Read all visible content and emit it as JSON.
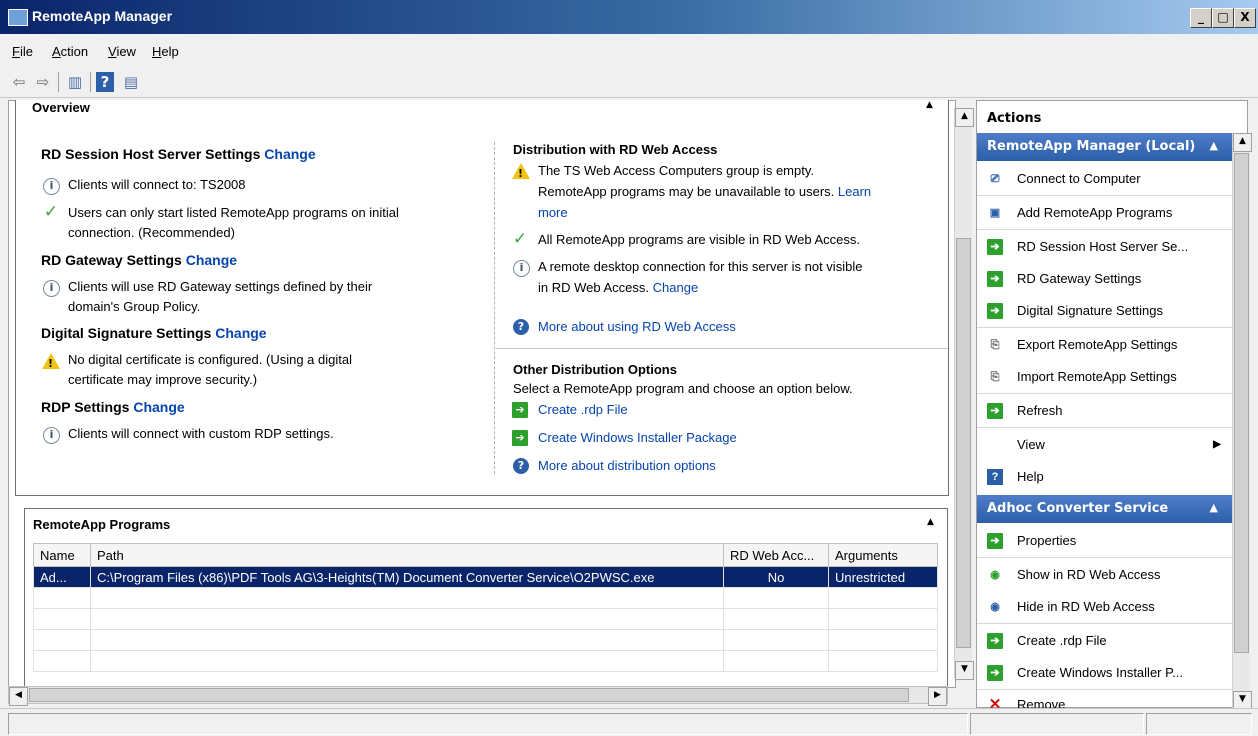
{
  "window": {
    "title": "RemoteApp Manager",
    "min": "_",
    "max": "□",
    "close": "X"
  },
  "menu": [
    "File",
    "Action",
    "View",
    "Help"
  ],
  "overview": {
    "title": "Overview",
    "session": {
      "heading": "RD Session Host Server Settings",
      "change": "Change",
      "line1": "Clients will connect to: TS2008",
      "line2": "Users can only start listed RemoteApp programs on initial",
      "line2b": "connection. (Recommended)"
    },
    "gateway": {
      "heading": "RD Gateway Settings",
      "change": "Change",
      "line1": "Clients will use RD Gateway settings defined by their",
      "line1b": "domain's Group Policy."
    },
    "signature": {
      "heading": "Digital Signature Settings",
      "change": "Change",
      "line1": "No digital certificate is configured. (Using a digital",
      "line1b": "certificate may improve security.)"
    },
    "rdp": {
      "heading": "RDP Settings",
      "change": "Change",
      "line1": "Clients will connect with custom RDP settings."
    },
    "webaccess": {
      "heading": "Distribution with RD Web Access",
      "warn1": "The TS Web Access Computers group is empty.",
      "warn1b": "RemoteApp programs may be unavailable to users.",
      "learn": "Learn",
      "more": "more",
      "line2": "All RemoteApp programs are visible in RD Web Access.",
      "line3": "A remote desktop connection for this server is not visible",
      "line3b": "in RD Web Access.",
      "change": "Change",
      "about": "More about using RD Web Access"
    },
    "other": {
      "heading": "Other Distribution Options",
      "desc": "Select a RemoteApp program and choose an option below.",
      "rdp": "Create .rdp File",
      "msi": "Create Windows Installer Package",
      "about": "More about distribution options"
    }
  },
  "programs": {
    "title": "RemoteApp Programs",
    "columns": [
      "Name",
      "Path",
      "RD Web Acc...",
      "Arguments"
    ],
    "rows": [
      {
        "name": "Ad...",
        "path": "C:\\Program Files (x86)\\PDF Tools AG\\3-Heights(TM) Document Converter Service\\O2PWSC.exe",
        "web": "No",
        "args": "Unrestricted"
      }
    ]
  },
  "actions": {
    "title": "Actions",
    "group1": "RemoteApp Manager (Local)",
    "items1": [
      "Connect to Computer",
      "Add RemoteApp Programs",
      "RD Session Host Server Se...",
      "RD Gateway Settings",
      "Digital Signature Settings",
      "Export RemoteApp Settings",
      "Import RemoteApp Settings",
      "Refresh",
      "View",
      "Help"
    ],
    "group2": "Adhoc Converter Service",
    "items2": [
      "Properties",
      "Show in RD Web Access",
      "Hide in RD Web Access",
      "Create .rdp File",
      "Create Windows Installer P...",
      "Remove"
    ]
  }
}
